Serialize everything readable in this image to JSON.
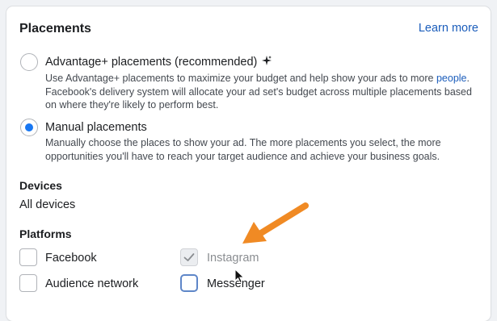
{
  "header": {
    "title": "Placements",
    "learn_more": "Learn more"
  },
  "advantage": {
    "label": "Advantage+ placements (recommended)",
    "desc_part1": "Use Advantage+ placements to maximize your budget and help show your ads to more ",
    "desc_link": "people",
    "desc_part2": ". Facebook's delivery system will allocate your ad set's budget across multiple placements based on where they're likely to perform best.",
    "selected": false
  },
  "manual": {
    "label": "Manual placements",
    "desc": "Manually choose the places to show your ad. The more placements you select, the more opportunities you'll have to reach your target audience and achieve your business goals.",
    "selected": true
  },
  "devices": {
    "heading": "Devices",
    "value": "All devices"
  },
  "platforms": {
    "heading": "Platforms",
    "items": [
      {
        "label": "Facebook",
        "checked": false,
        "disabled": false
      },
      {
        "label": "Instagram",
        "checked": true,
        "disabled": true
      },
      {
        "label": "Audience network",
        "checked": false,
        "disabled": false
      },
      {
        "label": "Messenger",
        "checked": false,
        "disabled": false
      }
    ]
  },
  "colors": {
    "accent": "#1877f2",
    "link": "#1b5dbb",
    "annotation_arrow": "#f08a24"
  }
}
